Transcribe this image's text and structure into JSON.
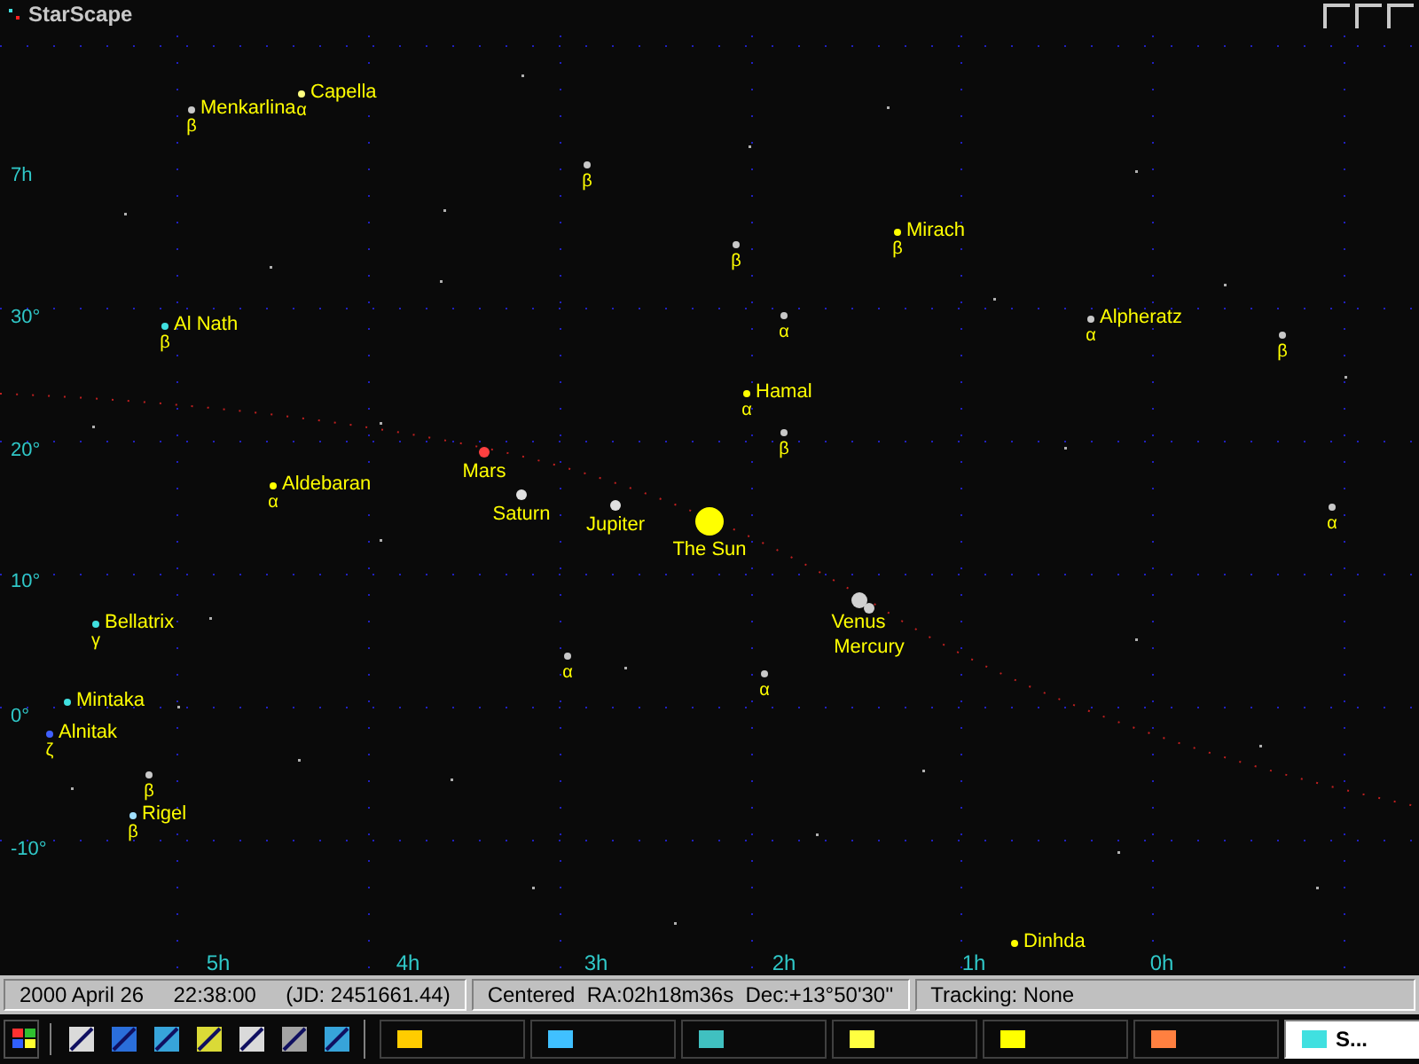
{
  "window": {
    "title": "StarScape"
  },
  "ra_labels": [
    "5h",
    "4h",
    "3h",
    "2h",
    "1h",
    "0h"
  ],
  "dec_labels": [
    "7h",
    "30°",
    "20°",
    "10°",
    "0°",
    "-10°"
  ],
  "bodies": [
    {
      "kind": "star",
      "name": "Menkarlina",
      "greek": "β",
      "color": "#c8c8c8"
    },
    {
      "kind": "star",
      "name": "Capella",
      "greek": "α",
      "color": "#ffff80"
    },
    {
      "kind": "star",
      "greek": "β",
      "color": "#c8c8c8"
    },
    {
      "kind": "star",
      "greek": "β",
      "color": "#c8c8c8"
    },
    {
      "kind": "star",
      "name": "Mirach",
      "greek": "β",
      "color": "#ffff00"
    },
    {
      "kind": "star",
      "name": "Al Nath",
      "greek": "β",
      "color": "#40e0e0"
    },
    {
      "kind": "star",
      "greek": "α",
      "color": "#c8c8c8"
    },
    {
      "kind": "star",
      "name": "Alpheratz",
      "greek": "α",
      "color": "#c8c8c8"
    },
    {
      "kind": "star",
      "greek": "β",
      "color": "#c8c8c8"
    },
    {
      "kind": "star",
      "name": "Hamal",
      "greek": "α",
      "color": "#ffff00"
    },
    {
      "kind": "star",
      "greek": "β",
      "color": "#c8c8c8"
    },
    {
      "kind": "planet",
      "name": "Mars",
      "color": "#ff4040"
    },
    {
      "kind": "star",
      "name": "Aldebaran",
      "greek": "α",
      "color": "#ffff00"
    },
    {
      "kind": "planet",
      "name": "Saturn",
      "color": "#e0e0e0"
    },
    {
      "kind": "planet",
      "name": "Jupiter",
      "color": "#e0e0e0"
    },
    {
      "kind": "sun",
      "name": "The Sun",
      "color": "#ffff00"
    },
    {
      "kind": "star",
      "greek": "α",
      "color": "#c8c8c8"
    },
    {
      "kind": "star",
      "name": "Bellatrix",
      "greek": "γ",
      "color": "#40e0e0"
    },
    {
      "kind": "planet",
      "name": "Venus",
      "color": "#d0d0d0"
    },
    {
      "kind": "planet",
      "name": "Mercury",
      "color": "#d0d0d0"
    },
    {
      "kind": "star",
      "greek": "α",
      "color": "#c8c8c8"
    },
    {
      "kind": "star",
      "greek": "α",
      "color": "#c8c8c8"
    },
    {
      "kind": "star",
      "name": "Mintaka",
      "color": "#40e0e0"
    },
    {
      "kind": "star",
      "name": "Alnitak",
      "greek": "ζ",
      "color": "#4060ff"
    },
    {
      "kind": "star",
      "greek": "β",
      "color": "#c8c8c8"
    },
    {
      "kind": "star",
      "name": "Rigel",
      "greek": "β",
      "color": "#a0e0ff"
    },
    {
      "kind": "star",
      "name": "Dinhda",
      "color": "#ffff00"
    }
  ],
  "status_bar": [
    "2000 April 26     22:38:00     (JD: 2451661.44)",
    "Centered  RA:02h18m36s  Dec:+13°50'30''",
    "Tracking: None"
  ],
  "taskbar": {
    "tasks": [
      {
        "selected": false
      },
      {
        "selected": false
      },
      {
        "selected": false
      },
      {
        "selected": false
      },
      {
        "selected": false
      },
      {
        "selected": false
      },
      {
        "label": "S...",
        "selected": true
      }
    ]
  }
}
